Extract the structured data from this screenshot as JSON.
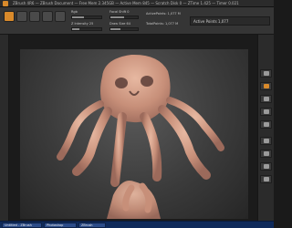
{
  "window": {
    "title": "ZBrush 4R6 — ZBrush Document — Free Mem 2.345GB — Active Mem 845 — Scratch Disk 0 — ZTime 1.425 — Timer 0.021"
  },
  "toolbar": {
    "focal_label": "Focal Shift 0",
    "draw_size_label": "Draw Size 64",
    "active_points_label": "ActivePoints: 1,077 M",
    "total_points_label": "TotalPoints: 1,077 M",
    "rgb_label": "Rgb",
    "z_intensity_label": "Z Intensity 25",
    "readout_label": "Active Points 1,077"
  },
  "status": {
    "task1": "Untitled - ZBrush",
    "task2": "Photoshop",
    "task3": "ZBrush"
  },
  "icons": [
    "zbrush-app-icon",
    "edit-icon",
    "draw-icon",
    "move-icon",
    "scale-icon",
    "rotate-icon",
    "bpr-icon",
    "scroll-icon",
    "zoom-icon",
    "actual-icon",
    "aahalf-icon",
    "frame-icon",
    "move-view-icon",
    "scale-view-icon",
    "rotate-view-icon"
  ],
  "colors": {
    "accent": "#d98a2b",
    "background": "#1a1a1a",
    "taskbar": "#0f2a5a",
    "sculpt": "#d9a58e"
  }
}
